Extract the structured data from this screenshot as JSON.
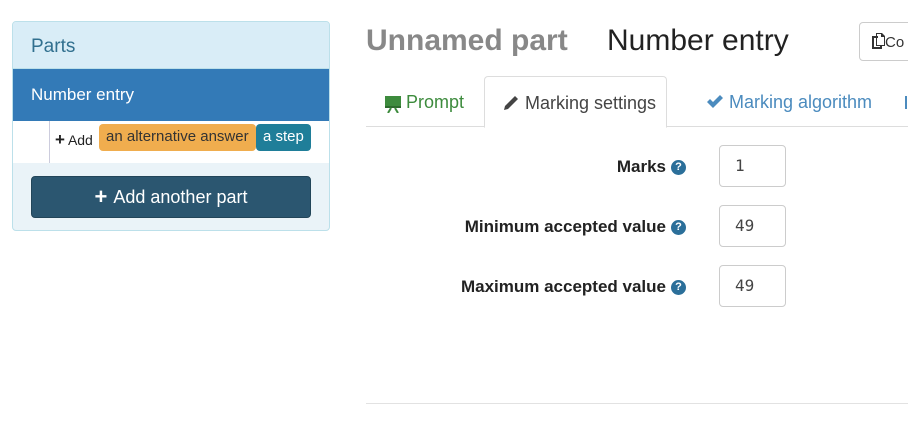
{
  "sidebar": {
    "header": "Parts",
    "part_item": "Number entry",
    "add_label": "Add",
    "alternative_badge": "an alternative answer",
    "step_badge": "a step",
    "add_part_button": "Add another part"
  },
  "header": {
    "part_name": "Unnamed part",
    "part_type": "Number entry",
    "copy_button": "Co"
  },
  "tabs": [
    {
      "label": "Prompt",
      "icon": "easel-icon",
      "color": "#3d8b3d"
    },
    {
      "label": "Marking settings",
      "icon": "pencil-icon",
      "active": true
    },
    {
      "label": "Marking algorithm",
      "icon": "check-icon",
      "color": "#4b8bbe"
    }
  ],
  "form": {
    "marks_label": "Marks",
    "marks_value": "1",
    "min_label": "Minimum accepted value",
    "min_value": "49",
    "max_label": "Maximum accepted value",
    "max_value": "49"
  },
  "colors": {
    "active_part": "#337ab7",
    "add_button": "#2b5670",
    "alternative_badge": "#f0ad4e",
    "step_badge": "#1f7e99"
  }
}
